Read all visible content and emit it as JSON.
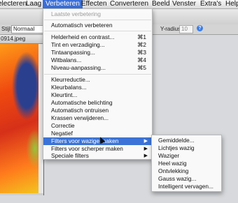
{
  "menubar": {
    "items": [
      "electeren",
      "Laag",
      "Verbeteren",
      "Effecten",
      "Converteren",
      "Beeld",
      "Venster",
      "Extra's",
      "Help"
    ],
    "active_index": 2
  },
  "toolbar": {
    "style_label": "Stijl:",
    "style_value": "Normaal",
    "yradius_label": "Y-radius:",
    "yradius_value": "10",
    "help_label": "?"
  },
  "document": {
    "title": "0914.jpeg"
  },
  "menu": {
    "items": [
      {
        "label": "Laatste verbetering",
        "shortcut": "",
        "disabled": true
      },
      {
        "label": "Automatisch verbeteren",
        "shortcut": ""
      },
      {
        "label": "Helderheid en contrast...",
        "shortcut": "⌘1"
      },
      {
        "label": "Tint en verzadiging...",
        "shortcut": "⌘2"
      },
      {
        "label": "Tintaanpassing...",
        "shortcut": "⌘3"
      },
      {
        "label": "Witbalans...",
        "shortcut": "⌘4"
      },
      {
        "label": "Niveau-aanpassing...",
        "shortcut": "⌘5"
      },
      {
        "label": "Kleurreductie...",
        "shortcut": ""
      },
      {
        "label": "Kleurbalans...",
        "shortcut": ""
      },
      {
        "label": "Kleurtint...",
        "shortcut": ""
      },
      {
        "label": "Automatische belichting",
        "shortcut": ""
      },
      {
        "label": "Automatisch ontruisen",
        "shortcut": ""
      },
      {
        "label": "Krassen verwijderen...",
        "shortcut": ""
      },
      {
        "label": "Correctie",
        "shortcut": ""
      },
      {
        "label": "Negatief",
        "shortcut": ""
      },
      {
        "label": "Filters voor wazige maken",
        "arrow": "▶",
        "highlighted": true
      },
      {
        "label": "Filters voor scherper maken",
        "arrow": "▶"
      },
      {
        "label": "Speciale filters",
        "arrow": "▶"
      }
    ]
  },
  "submenu": {
    "items": [
      "Gemiddelde...",
      "Lichtjes wazig",
      "Waziger",
      "Heel wazig",
      "Ontvlekking",
      "Gauss wazig...",
      "Intelligent vervagen..."
    ]
  },
  "colors": {
    "highlight": "#3b73d6"
  }
}
